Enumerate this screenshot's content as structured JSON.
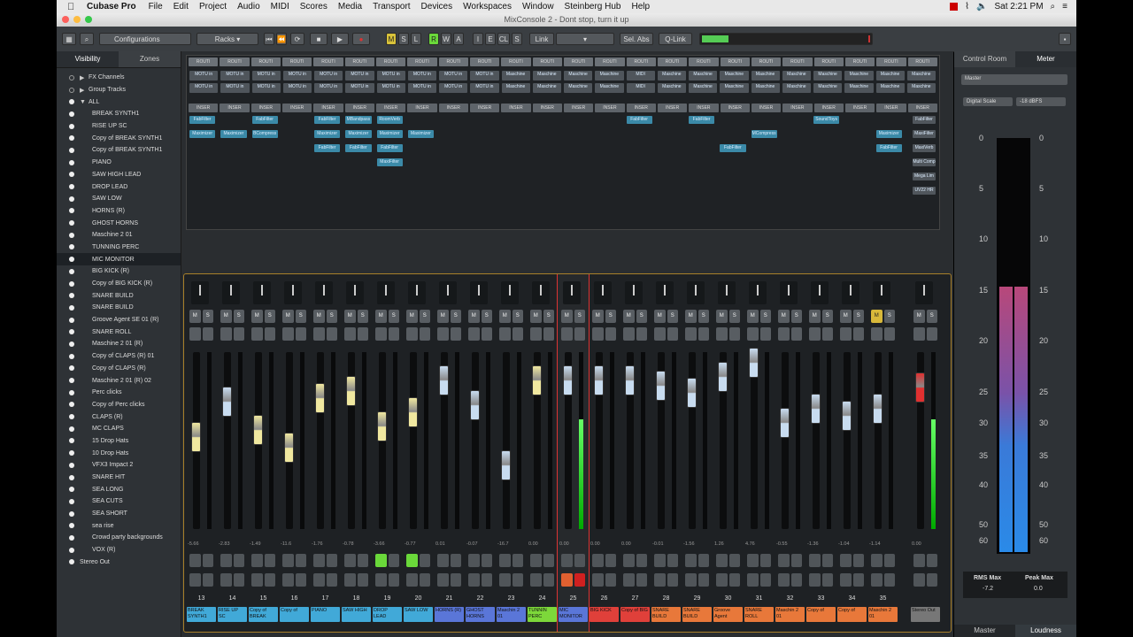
{
  "menubar": {
    "app": "Cubase Pro",
    "items": [
      "File",
      "Edit",
      "Project",
      "Audio",
      "MIDI",
      "Scores",
      "Media",
      "Transport",
      "Devices",
      "Workspaces",
      "Window",
      "Steinberg Hub",
      "Help"
    ],
    "clock": "Sat 2:21 PM"
  },
  "window": {
    "title": "MixConsole 2 - Dont stop, turn it up"
  },
  "toolbar": {
    "configurations": "Configurations",
    "racks": "Racks",
    "link": "Link",
    "sel_abs": "Sel. Abs",
    "q_link": "Q-Link",
    "m": "M",
    "s": "S",
    "l": "L",
    "r": "R",
    "w": "W",
    "a": "A",
    "i": "I",
    "e": "E",
    "cl": "CL",
    "num_s": "S"
  },
  "left_panel": {
    "tabs": [
      "Visibility",
      "Zones"
    ],
    "items": [
      {
        "label": "FX Channels",
        "on": false,
        "arrow": "▶"
      },
      {
        "label": "Group Tracks",
        "on": false,
        "arrow": "▶"
      },
      {
        "label": "ALL",
        "on": true,
        "arrow": "▼"
      },
      {
        "label": "BREAK SYNTH1",
        "on": true
      },
      {
        "label": "RISE UP SC",
        "on": true
      },
      {
        "label": "Copy of BREAK SYNTH1",
        "on": true
      },
      {
        "label": "Copy of BREAK SYNTH1",
        "on": true
      },
      {
        "label": "PIANO",
        "on": true
      },
      {
        "label": "SAW HIGH LEAD",
        "on": true
      },
      {
        "label": "DROP LEAD",
        "on": true
      },
      {
        "label": "SAW LOW",
        "on": true
      },
      {
        "label": "HORNS (R)",
        "on": true
      },
      {
        "label": "GHOST HORNS",
        "on": true
      },
      {
        "label": "Maschine 2 01",
        "on": true
      },
      {
        "label": "TUNNING PERC",
        "on": true
      },
      {
        "label": "MIC MONITOR",
        "on": true,
        "selected": true
      },
      {
        "label": "BIG KICK (R)",
        "on": true
      },
      {
        "label": "Copy of BIG KICK (R)",
        "on": true
      },
      {
        "label": "SNARE BUILD",
        "on": true
      },
      {
        "label": "SNARE BUILD",
        "on": true
      },
      {
        "label": "Groove Agent SE 01 (R)",
        "on": true
      },
      {
        "label": "SNARE ROLL",
        "on": true
      },
      {
        "label": "Maschine 2 01 (R)",
        "on": true
      },
      {
        "label": "Copy of CLAPS (R) 01",
        "on": true
      },
      {
        "label": "Copy of CLAPS (R)",
        "on": true
      },
      {
        "label": "Maschine 2 01 (R) 02",
        "on": true
      },
      {
        "label": "Perc clicks",
        "on": true
      },
      {
        "label": "Copy of Perc clicks",
        "on": true
      },
      {
        "label": "CLAPS (R)",
        "on": true
      },
      {
        "label": "MC CLAPS",
        "on": true
      },
      {
        "label": "15 Drop Hats",
        "on": true
      },
      {
        "label": "10 Drop Hats",
        "on": true
      },
      {
        "label": "VFX3 Impact 2",
        "on": true
      },
      {
        "label": "SNARE HIT",
        "on": true
      },
      {
        "label": "SEA LONG",
        "on": true
      },
      {
        "label": "SEA CUTS",
        "on": true
      },
      {
        "label": "SEA SHORT",
        "on": true
      },
      {
        "label": "sea rise",
        "on": true
      },
      {
        "label": "Crowd party backgrounds",
        "on": true
      },
      {
        "label": "VOX (R)",
        "on": true
      },
      {
        "label": "Stereo Out",
        "on": true,
        "top": true
      }
    ]
  },
  "racks": {
    "route_label": "ROUTI",
    "insert_label": "INSER",
    "io_labels": [
      "MOTU in",
      "MOTU in",
      "MOTU in",
      "MOTU in",
      "MOTU in",
      "MOTU in",
      "MOTU in",
      "MOTU in",
      "MOTU in",
      "MOTU in",
      "Maschine",
      "Maschine",
      "Maschine",
      "Maschine",
      "MIDI",
      "Maschine",
      "Maschine",
      "Maschine",
      "Maschine",
      "Maschine",
      "Maschine",
      "Maschine",
      "Maschine",
      "Maschine"
    ],
    "plugins": [
      {
        "label": "FabFilter",
        "col": 0,
        "row": 0
      },
      {
        "label": "FabFilter",
        "col": 2,
        "row": 0
      },
      {
        "label": "FabFilter",
        "col": 4,
        "row": 0
      },
      {
        "label": "MBandpass",
        "col": 5,
        "row": 0
      },
      {
        "label": "RoomVerb",
        "col": 6,
        "row": 0
      },
      {
        "label": "FabFilter",
        "col": 14,
        "row": 0
      },
      {
        "label": "FabFilter",
        "col": 16,
        "row": 0
      },
      {
        "label": "SoundToys",
        "col": 20,
        "row": 0
      },
      {
        "label": "Maximizer",
        "col": 0,
        "row": 1
      },
      {
        "label": "Maximizer",
        "col": 1,
        "row": 1
      },
      {
        "label": "BCompress",
        "col": 2,
        "row": 1
      },
      {
        "label": "Maximizer",
        "col": 4,
        "row": 1
      },
      {
        "label": "Maximizer",
        "col": 5,
        "row": 1
      },
      {
        "label": "Maximizer",
        "col": 6,
        "row": 1
      },
      {
        "label": "Maximizer",
        "col": 7,
        "row": 1
      },
      {
        "label": "MCompress",
        "col": 18,
        "row": 1
      },
      {
        "label": "Maximizer",
        "col": 22,
        "row": 1
      },
      {
        "label": "FabFilter",
        "col": 4,
        "row": 2
      },
      {
        "label": "FabFilter",
        "col": 5,
        "row": 2
      },
      {
        "label": "FabFilter",
        "col": 6,
        "row": 2
      },
      {
        "label": "FabFilter",
        "col": 17,
        "row": 2
      },
      {
        "label": "FabFilter",
        "col": 22,
        "row": 2
      },
      {
        "label": "MaxiFilter",
        "col": 6,
        "row": 3
      }
    ],
    "master_plugins": [
      "FabFilter",
      "MaxiFilter",
      "MaxiVerb",
      "Multi Comp",
      "Mega Lim",
      "UV22 HR"
    ]
  },
  "channels": [
    {
      "num": "13",
      "name": "BREAK SYNTH1",
      "color": "#41a9d8",
      "fader": 0.52,
      "val": "-5.66"
    },
    {
      "num": "14",
      "name": "RISE UP SC",
      "color": "#41a9d8",
      "fader": 0.72,
      "val": "-2.83"
    },
    {
      "num": "15",
      "name": "Copy of BREAK",
      "color": "#41a9d8",
      "fader": 0.56,
      "val": "-1.49"
    },
    {
      "num": "16",
      "name": "Copy of",
      "color": "#41a9d8",
      "fader": 0.46,
      "val": "-11.6"
    },
    {
      "num": "17",
      "name": "PIANO",
      "color": "#41a9d8",
      "fader": 0.74,
      "val": "-1.76"
    },
    {
      "num": "18",
      "name": "SAW HIGH",
      "color": "#41a9d8",
      "fader": 0.78,
      "val": "-0.78"
    },
    {
      "num": "19",
      "name": "DROP LEAD",
      "color": "#41a9d8",
      "fader": 0.58,
      "val": "-3.66"
    },
    {
      "num": "20",
      "name": "SAW LOW",
      "color": "#41a9d8",
      "fader": 0.66,
      "val": "-0.77"
    },
    {
      "num": "21",
      "name": "HORNS (R)",
      "color": "#5a76d8",
      "fader": 0.84,
      "val": "0.01"
    },
    {
      "num": "22",
      "name": "GHOST HORNS",
      "color": "#5a76d8",
      "fader": 0.7,
      "val": "-0.07"
    },
    {
      "num": "23",
      "name": "Maschin 2 01",
      "color": "#5a76d8",
      "fader": 0.36,
      "val": "-16.7"
    },
    {
      "num": "24",
      "name": "TUNNIN PERC",
      "color": "#7dd83a",
      "fader": 0.84,
      "val": "0.00"
    },
    {
      "num": "25",
      "name": "MIC MONITOR",
      "color": "#5a76d8",
      "fader": 0.84,
      "val": "0.00",
      "selected": true
    },
    {
      "num": "26",
      "name": "BIG KICK",
      "color": "#e0403a",
      "fader": 0.84,
      "val": "0.00"
    },
    {
      "num": "27",
      "name": "Copy of BIG",
      "color": "#e0403a",
      "fader": 0.84,
      "val": "0.00"
    },
    {
      "num": "28",
      "name": "SNARE BUILD",
      "color": "#e8783a",
      "fader": 0.81,
      "val": "-0.01"
    },
    {
      "num": "29",
      "name": "SNARE BUILD",
      "color": "#e8783a",
      "fader": 0.77,
      "val": "-1.56"
    },
    {
      "num": "30",
      "name": "Groove Agent",
      "color": "#e8783a",
      "fader": 0.86,
      "val": "1.26"
    },
    {
      "num": "31",
      "name": "SNARE ROLL",
      "color": "#e8783a",
      "fader": 0.94,
      "val": "4.76"
    },
    {
      "num": "32",
      "name": "Maschin 2 01",
      "color": "#e8783a",
      "fader": 0.6,
      "val": "-0.55"
    },
    {
      "num": "33",
      "name": "Copy of",
      "color": "#e8783a",
      "fader": 0.68,
      "val": "-1.36"
    },
    {
      "num": "34",
      "name": "Copy of",
      "color": "#e8783a",
      "fader": 0.64,
      "val": "-1.04"
    },
    {
      "num": "35",
      "name": "Maschin 2 01",
      "color": "#e8783a",
      "fader": 0.68,
      "val": "-1.14"
    }
  ],
  "master_channel": {
    "name": "Stereo Out",
    "fader": 0.8,
    "val": "0.00"
  },
  "right_panel": {
    "tabs": [
      "Control Room",
      "Meter"
    ],
    "source": "Master",
    "digital_scale": "Digital Scale",
    "scale_value": "-18 dBFS",
    "db_scale": [
      "0",
      "5",
      "10",
      "15",
      "20",
      "25",
      "30",
      "35",
      "40",
      "50",
      "60"
    ],
    "rms_max_label": "RMS Max",
    "rms_max": "-7.2",
    "peak_max_label": "Peak Max",
    "peak_max": "0.0",
    "bottom_tabs": [
      "Master",
      "Loudness"
    ]
  },
  "colors": {
    "accent": "#a9802a",
    "fader_cap_blue": "#c8dcf0",
    "fader_cap_yellow": "#f0e8a0",
    "fader_cap_red": "#e03030"
  }
}
